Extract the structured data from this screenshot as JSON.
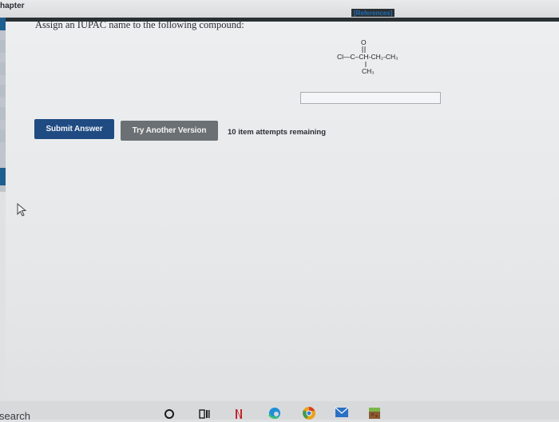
{
  "header": {
    "chapter_label": "hapter",
    "references_label": "[References]"
  },
  "question": {
    "prompt": "Assign an IUPAC name to the following compound:"
  },
  "compound": {
    "oxygen": "O",
    "main_chain": "Cl—C–CH-CH₂-CH₃",
    "substituent": "CH₃"
  },
  "answer": {
    "value": "",
    "placeholder": ""
  },
  "actions": {
    "submit_label": "Submit Answer",
    "try_another_label": "Try Another Version",
    "attempts_text": "10 item attempts remaining"
  },
  "taskbar": {
    "search_label": "search",
    "icons": [
      "cortana-circle-icon",
      "task-view-icon",
      "netflix-icon",
      "edge-icon",
      "chrome-icon",
      "mail-icon",
      "minecraft-icon"
    ]
  },
  "colors": {
    "submit_button": "#1f4b82",
    "try_another_button": "#6b7074",
    "references_link": "#1e6fb8",
    "left_tab": "#1f5f8f"
  }
}
